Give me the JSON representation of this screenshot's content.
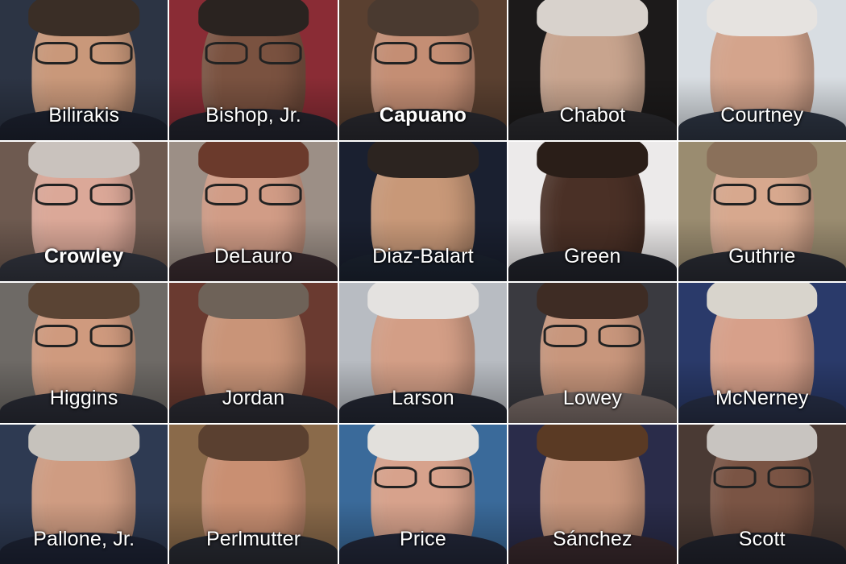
{
  "tiles": [
    {
      "name": "Bilirakis",
      "bold": false,
      "bg": "#2c3444",
      "skin": "#c9987a",
      "hair": "#3a2e26",
      "suit": "#1d2230",
      "glasses": true
    },
    {
      "name": "Bishop, Jr.",
      "bold": false,
      "bg": "#8a2c35",
      "skin": "#7a5240",
      "hair": "#2a2320",
      "suit": "#23242e",
      "glasses": true
    },
    {
      "name": "Capuano",
      "bold": true,
      "bg": "#5a4030",
      "skin": "#c48e74",
      "hair": "#4a3a30",
      "suit": "#2a2a30",
      "glasses": true
    },
    {
      "name": "Chabot",
      "bold": false,
      "bg": "#1c1a1a",
      "skin": "#c8a48e",
      "hair": "#d8d2cc",
      "suit": "#2a2a2e",
      "glasses": false
    },
    {
      "name": "Courtney",
      "bold": false,
      "bg": "#d8dde2",
      "skin": "#d4a48c",
      "hair": "#e6e3e0",
      "suit": "#2e3644",
      "glasses": false
    },
    {
      "name": "Crowley",
      "bold": true,
      "bg": "#6e5a50",
      "skin": "#dba898",
      "hair": "#c9c2bd",
      "suit": "#333640",
      "glasses": true
    },
    {
      "name": "DeLauro",
      "bold": false,
      "bg": "#9c8f86",
      "skin": "#d19c86",
      "hair": "#6b3a2c",
      "suit": "#3a2c30",
      "glasses": true
    },
    {
      "name": "Diaz-Balart",
      "bold": false,
      "bg": "#1a2030",
      "skin": "#c89878",
      "hair": "#2c2420",
      "suit": "#1c2432",
      "glasses": false
    },
    {
      "name": "Green",
      "bold": false,
      "bg": "#eceaea",
      "skin": "#4a3026",
      "hair": "#2a1e18",
      "suit": "#22242c",
      "glasses": false
    },
    {
      "name": "Guthrie",
      "bold": false,
      "bg": "#9a8c70",
      "skin": "#d7a88e",
      "hair": "#8a705a",
      "suit": "#2a2c34",
      "glasses": true
    },
    {
      "name": "Higgins",
      "bold": false,
      "bg": "#6e6a66",
      "skin": "#cf9a7e",
      "hair": "#5a4434",
      "suit": "#2a2c36",
      "glasses": true
    },
    {
      "name": "Jordan",
      "bold": false,
      "bg": "#6a3a30",
      "skin": "#c99478",
      "hair": "#6e6258",
      "suit": "#2c2c34",
      "glasses": false
    },
    {
      "name": "Larson",
      "bold": false,
      "bg": "#b8bcc2",
      "skin": "#d39e86",
      "hair": "#e4e2e0",
      "suit": "#242834",
      "glasses": false
    },
    {
      "name": "Lowey",
      "bold": false,
      "bg": "#3a3a40",
      "skin": "#c8967c",
      "hair": "#3e2c24",
      "suit": "#7a6c68",
      "glasses": true
    },
    {
      "name": "McNerney",
      "bold": false,
      "bg": "#2a3a6a",
      "skin": "#d7a08a",
      "hair": "#d8d4cc",
      "suit": "#283048",
      "glasses": false
    },
    {
      "name": "Pallone, Jr.",
      "bold": false,
      "bg": "#2e3a52",
      "skin": "#cf9c82",
      "hair": "#c6c2bc",
      "suit": "#1e2436",
      "glasses": false
    },
    {
      "name": "Perlmutter",
      "bold": false,
      "bg": "#8a6a4a",
      "skin": "#c98f72",
      "hair": "#5a4030",
      "suit": "#2a2c34",
      "glasses": false
    },
    {
      "name": "Price",
      "bold": false,
      "bg": "#3a6a9a",
      "skin": "#d7a28c",
      "hair": "#e2e0dc",
      "suit": "#23283a",
      "glasses": true
    },
    {
      "name": "Sánchez",
      "bold": false,
      "bg": "#2a2c4a",
      "skin": "#c8967c",
      "hair": "#5a3a24",
      "suit": "#3a2a2e",
      "glasses": false
    },
    {
      "name": "Scott",
      "bold": false,
      "bg": "#4a3a34",
      "skin": "#7a5444",
      "hair": "#c8c4c0",
      "suit": "#22242e",
      "glasses": true
    }
  ]
}
